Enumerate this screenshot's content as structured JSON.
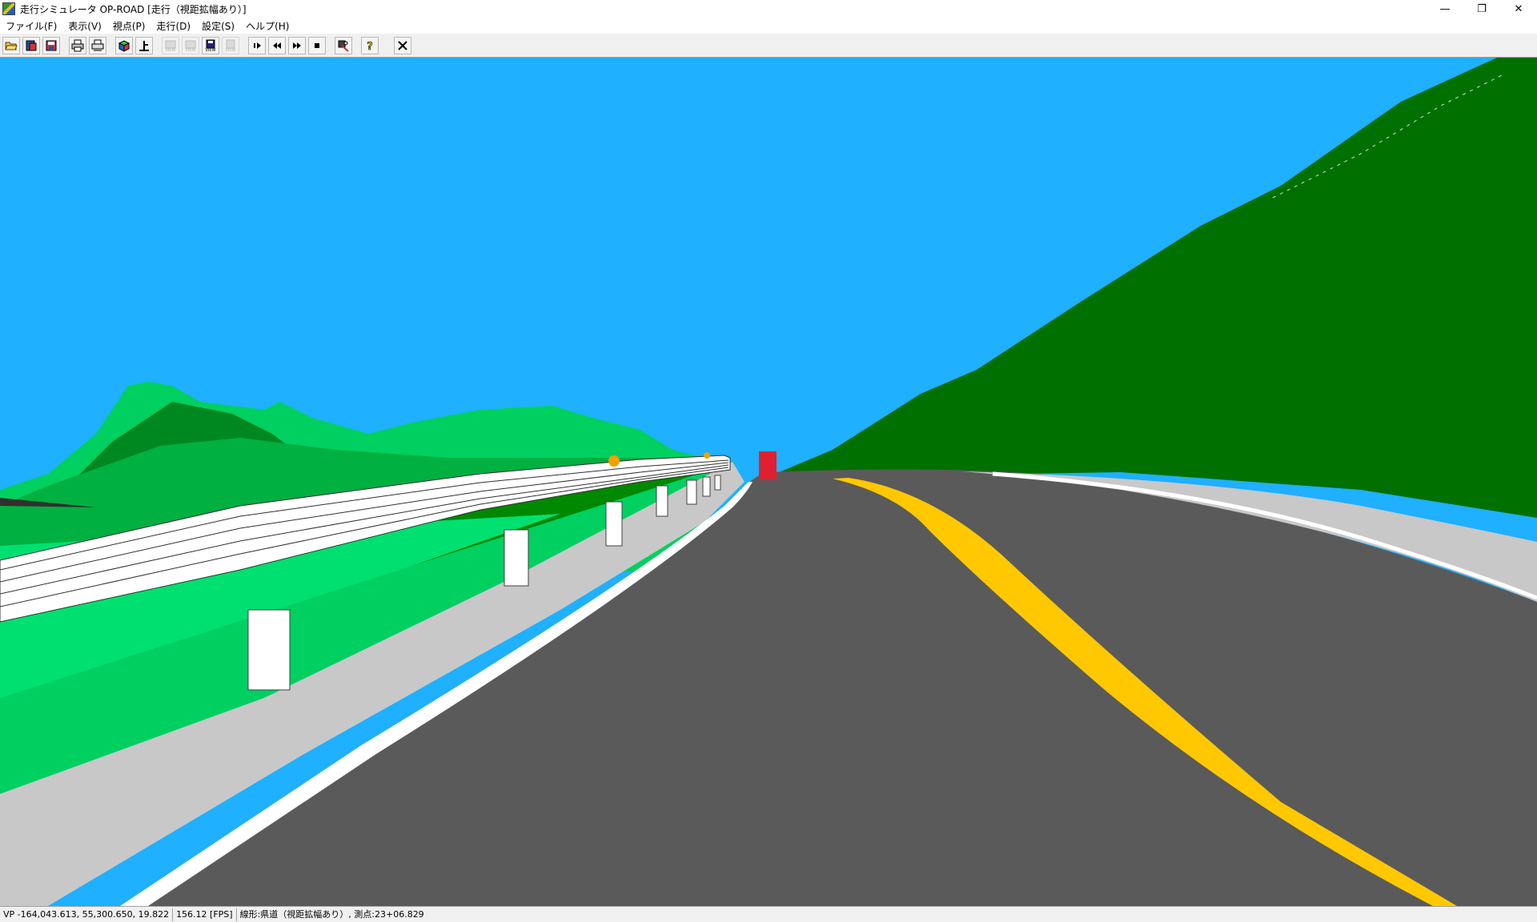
{
  "window": {
    "title": "走行シミュレータ OP-ROAD [走行（視距拡幅あり）]",
    "minimize_glyph": "—",
    "maximize_glyph": "❐",
    "close_glyph": "✕"
  },
  "menu": {
    "items": [
      {
        "label": "ファイル(F)"
      },
      {
        "label": "表示(V)"
      },
      {
        "label": "視点(P)"
      },
      {
        "label": "走行(D)"
      },
      {
        "label": "設定(S)"
      },
      {
        "label": "ヘルプ(H)"
      }
    ]
  },
  "toolbar": {
    "buttons": [
      {
        "name": "open-folder-icon",
        "enabled": true
      },
      {
        "name": "open-data-icon",
        "enabled": true
      },
      {
        "name": "save-data-icon",
        "enabled": true
      },
      {
        "name": "print-icon",
        "enabled": true
      },
      {
        "name": "print-preview-icon",
        "enabled": true
      },
      {
        "name": "3d-view-icon",
        "enabled": true
      },
      {
        "name": "top-view-icon",
        "enabled": true,
        "label": "上"
      },
      {
        "name": "view-1-icon",
        "enabled": false,
        "label": "VIEW"
      },
      {
        "name": "view-2-icon",
        "enabled": false,
        "label": "VIEW"
      },
      {
        "name": "view-save-icon",
        "enabled": true,
        "label": "VIEW"
      },
      {
        "name": "view-4-icon",
        "enabled": false,
        "label": "VIEW"
      },
      {
        "name": "play-icon",
        "enabled": true
      },
      {
        "name": "rewind-icon",
        "enabled": true
      },
      {
        "name": "fast-forward-icon",
        "enabled": true
      },
      {
        "name": "stop-icon",
        "enabled": true
      },
      {
        "name": "settings-tool-icon",
        "enabled": true
      },
      {
        "name": "help-icon",
        "enabled": true
      },
      {
        "name": "close-view-icon",
        "enabled": true
      }
    ]
  },
  "scene": {
    "sky_color": "#1fb0ff",
    "road_color": "#5a5a5a",
    "center_line_color": "#ffc800",
    "edge_line_color": "#ffffff",
    "shoulder_color": "#c8c8c8",
    "hill_dark_color": "#007000",
    "hill_light_color": "#00d060",
    "guardrail_color": "#ffffff",
    "marker_color": "#e02030"
  },
  "status": {
    "viewpoint": "VP -164,043.613, 55,300.650, 19.822",
    "fps": "156.12 [FPS]",
    "alignment": "線形:県道（視距拡幅あり）, 測点:23+06.829"
  }
}
